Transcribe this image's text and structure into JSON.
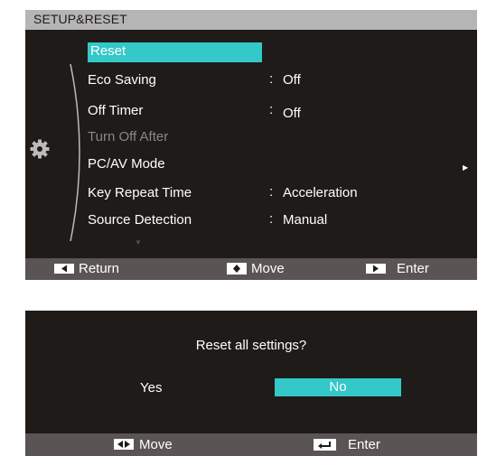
{
  "osd": {
    "title": "SETUP&RESET",
    "items": [
      {
        "label": "Reset",
        "selected": true
      },
      {
        "label": "Eco Saving",
        "value": "Off"
      },
      {
        "label": "Off Timer",
        "value": "Off"
      },
      {
        "label": "Turn Off After",
        "disabled": true
      },
      {
        "label": "PC/AV Mode",
        "has_submenu": true
      },
      {
        "label": "Key Repeat Time",
        "value": "Acceleration"
      },
      {
        "label": "Source Detection",
        "value": "Manual"
      }
    ],
    "colon": ":",
    "icons": {
      "category": "gear-icon",
      "submenu": "triangle-right-icon",
      "scroll": "triangle-down-icon"
    },
    "footer": {
      "return": "Return",
      "move": "Move",
      "enter": "Enter"
    }
  },
  "dialog": {
    "question": "Reset all settings?",
    "yes": "Yes",
    "no": "No",
    "selected": "No",
    "footer": {
      "move": "Move",
      "enter": "Enter"
    }
  },
  "colors": {
    "panel": "#1f1b19",
    "title_bar": "#b6b5b5",
    "highlight": "#34c8c8",
    "footer": "#5a5554",
    "disabled": "#8a8786"
  }
}
